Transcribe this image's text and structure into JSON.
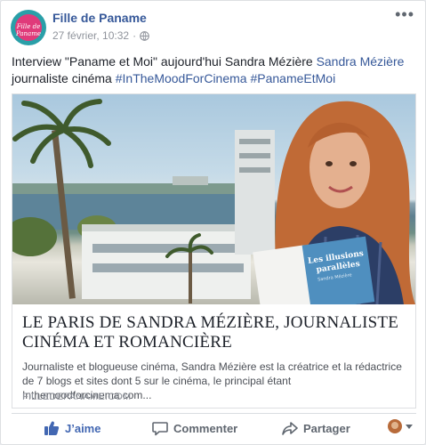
{
  "post": {
    "page_name": "Fille de Paname",
    "avatar_text": "Fille de Paname",
    "date": "27 février, 10:32",
    "separator": "·",
    "text": {
      "intro": "Interview \"Paname et Moi\" aujourd'hui Sandra Mézière ",
      "mention": "Sandra Mézière",
      "middle": " journaliste cinéma ",
      "hashtag1": "#InTheMoodForCinema",
      "hashtag2": "#PanameEtMoi"
    }
  },
  "link_preview": {
    "book_title": "Les illusions parallèles",
    "book_author": "Sandra Mézière",
    "title": "LE PARIS DE SANDRA MÉZIÈRE, JOURNALISTE CINÉMA ET ROMANCIÈRE",
    "description": "Journaliste et blogueuse cinéma, Sandra Mézière est la créatrice et la rédactrice de 7 blogs et sites dont 5 sur le cinéma, le principal étant Inthemoodforcinema.com...",
    "domain": "FILLEDEPANAME.COM"
  },
  "actions": {
    "like": "J’aime",
    "comment": "Commenter",
    "share": "Partager"
  },
  "icons": {
    "globe": "globe-icon",
    "more": "more-options-icon",
    "like": "thumbs-up-icon",
    "comment": "comment-bubble-icon",
    "share": "share-arrow-icon"
  },
  "colors": {
    "link": "#365899",
    "like_active": "#4267b2",
    "meta": "#90949c"
  }
}
